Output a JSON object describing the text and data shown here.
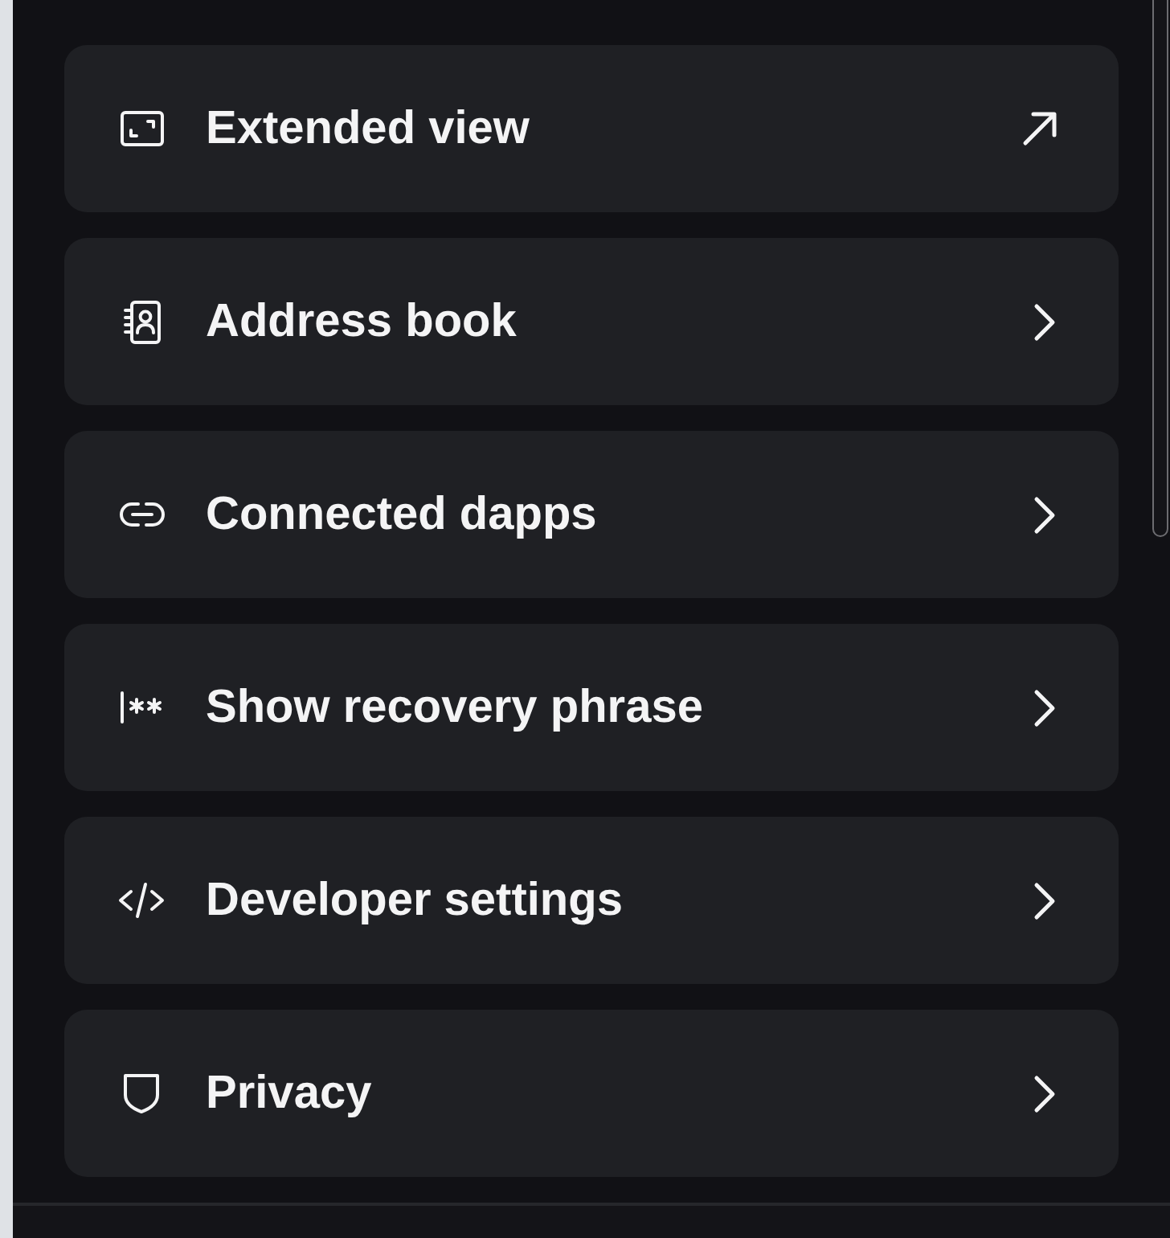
{
  "menu": {
    "items": [
      {
        "label": "Extended view",
        "kind": "external"
      },
      {
        "label": "Address book",
        "kind": "page"
      },
      {
        "label": "Connected dapps",
        "kind": "page"
      },
      {
        "label": "Show recovery phrase",
        "kind": "page"
      },
      {
        "label": "Developer settings",
        "kind": "page"
      },
      {
        "label": "Privacy",
        "kind": "page"
      }
    ]
  }
}
